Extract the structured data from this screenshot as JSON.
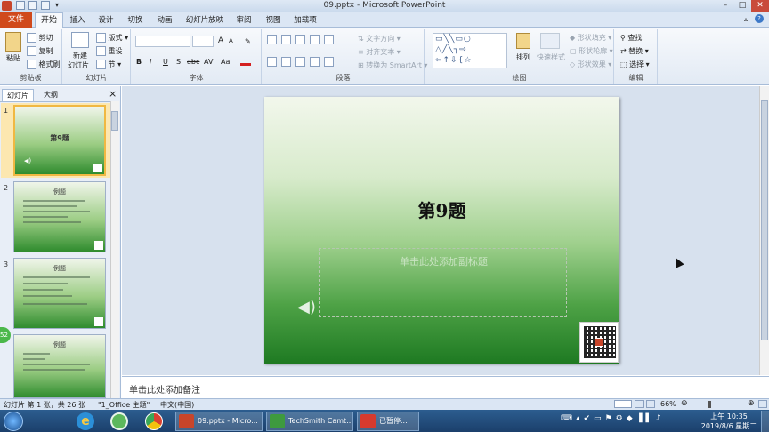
{
  "window": {
    "title": "09.pptx - Microsoft PowerPoint"
  },
  "tabs": {
    "file": "文件",
    "home": "开始",
    "items": [
      "插入",
      "设计",
      "切换",
      "动画",
      "幻灯片放映",
      "审阅",
      "视图",
      "加载项"
    ]
  },
  "ribbon": {
    "clipboard": {
      "label": "剪贴板",
      "paste": "粘贴",
      "cut": "剪切",
      "copy": "复制",
      "format_painter": "格式刷"
    },
    "slides": {
      "label": "幻灯片",
      "new_slide": "新建",
      "new_slide2": "幻灯片",
      "layout": "版式",
      "reset": "重设",
      "section": "节"
    },
    "font": {
      "label": "字体",
      "bold": "B",
      "italic": "I",
      "underline": "U",
      "strike": "S",
      "shadow": "abc",
      "spacing": "AV",
      "case": "Aa",
      "grow": "A",
      "shrink": "A"
    },
    "paragraph": {
      "label": "段落",
      "direction": "文字方向",
      "align": "对齐文本",
      "smartart": "转换为 SmartArt"
    },
    "drawing": {
      "label": "绘图",
      "arrange": "排列",
      "quick_styles": "快速样式",
      "fill": "形状填充",
      "outline": "形状轮廓",
      "effects": "形状效果"
    },
    "editing": {
      "label": "编辑",
      "find": "查找",
      "replace": "替换",
      "select": "选择"
    }
  },
  "panel": {
    "tab_slides": "幻灯片",
    "tab_outline": "大纲",
    "close": "×"
  },
  "thumbnails": [
    {
      "num": "1",
      "title": "第9题",
      "selected": true
    },
    {
      "num": "2",
      "title": "例题",
      "selected": false
    },
    {
      "num": "3",
      "title": "例题",
      "selected": false
    },
    {
      "num": "4",
      "title": "例题",
      "selected": false
    }
  ],
  "slide": {
    "title": "第9题",
    "placeholder": "单击此处添加副标题"
  },
  "notes": {
    "text": "单击此处添加备注"
  },
  "status": {
    "slide_info": "幻灯片 第 1 张，共 26 张",
    "theme": "\"1_Office 主题\"",
    "language": "中文(中国)",
    "zoom": "66%"
  },
  "taskbar": {
    "tasks": [
      {
        "label": "09.pptx - Micro...",
        "color": "#c8452a"
      },
      {
        "label": "TechSmith Camt...",
        "color": "#3e9a3e"
      },
      {
        "label": "已暂停...",
        "color": "#d63a2e"
      }
    ],
    "clock_time": "上午 10:35",
    "clock_date": "2019/8/6 星期二"
  },
  "colors": {
    "file_tab": "#d04a1c",
    "ribbon_bg": "#e2eaf4",
    "taskbar": "#1b3f6b",
    "slide_green": "#1e7a22"
  }
}
